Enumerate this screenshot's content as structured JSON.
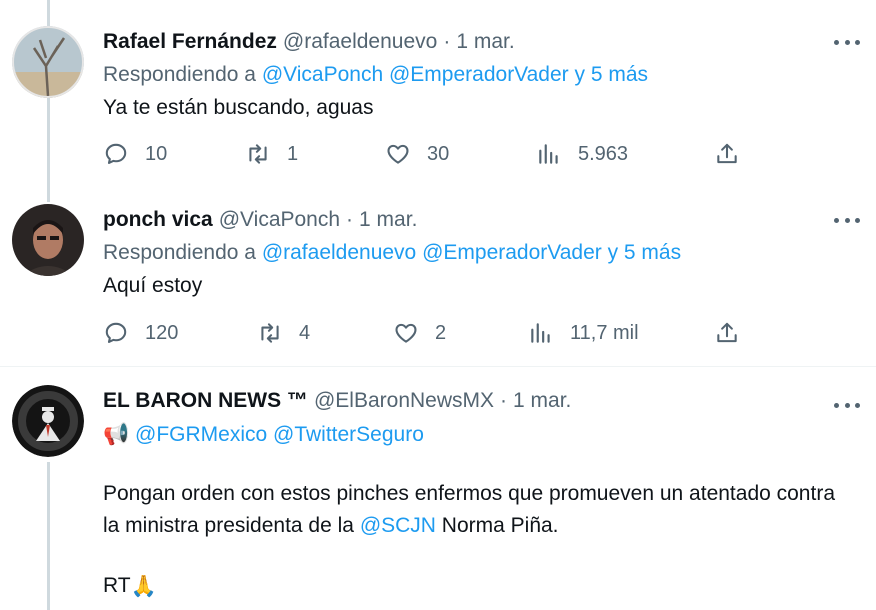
{
  "tweets": [
    {
      "name": "Rafael Fernández",
      "handle": "@rafaeldenuevo",
      "separator": "·",
      "time": "1 mar.",
      "replying_prefix": "Respondiendo a",
      "replying_handles": "@VicaPonch @EmperadorVader y 5 más",
      "text": "Ya te están buscando, aguas",
      "replies": "10",
      "retweets": "1",
      "likes": "30",
      "views": "5.963"
    },
    {
      "name": "ponch vica",
      "handle": "@VicaPonch",
      "separator": "·",
      "time": "1 mar.",
      "replying_prefix": "Respondiendo a",
      "replying_handles": "@rafaeldenuevo @EmperadorVader y 5 más",
      "text": "Aquí estoy",
      "replies": "120",
      "retweets": "4",
      "likes": "2",
      "views": "11,7 mil"
    },
    {
      "name": "EL BARON NEWS ™",
      "handle": "@ElBaronNewsMX",
      "separator": "·",
      "time": "1 mar.",
      "mention_line_emoji": "📢",
      "mention_line": "@FGRMexico @TwitterSeguro",
      "text_part1": "Pongan orden con estos pinches enfermos que promueven un atentado contra la ministra presidenta de la ",
      "text_mention": "@SCJN",
      "text_part2": " Norma Piña.",
      "rt_text": "RT",
      "rt_emoji": "🙏"
    }
  ],
  "icons": {
    "reply": "reply-icon",
    "retweet": "retweet-icon",
    "like": "heart-icon",
    "views": "analytics-icon",
    "share": "share-icon",
    "more": "more-icon"
  },
  "colors": {
    "link": "#1d9bf0",
    "secondary_text": "#536471",
    "primary_text": "#0f1419",
    "thread_line": "#cfd9de"
  }
}
